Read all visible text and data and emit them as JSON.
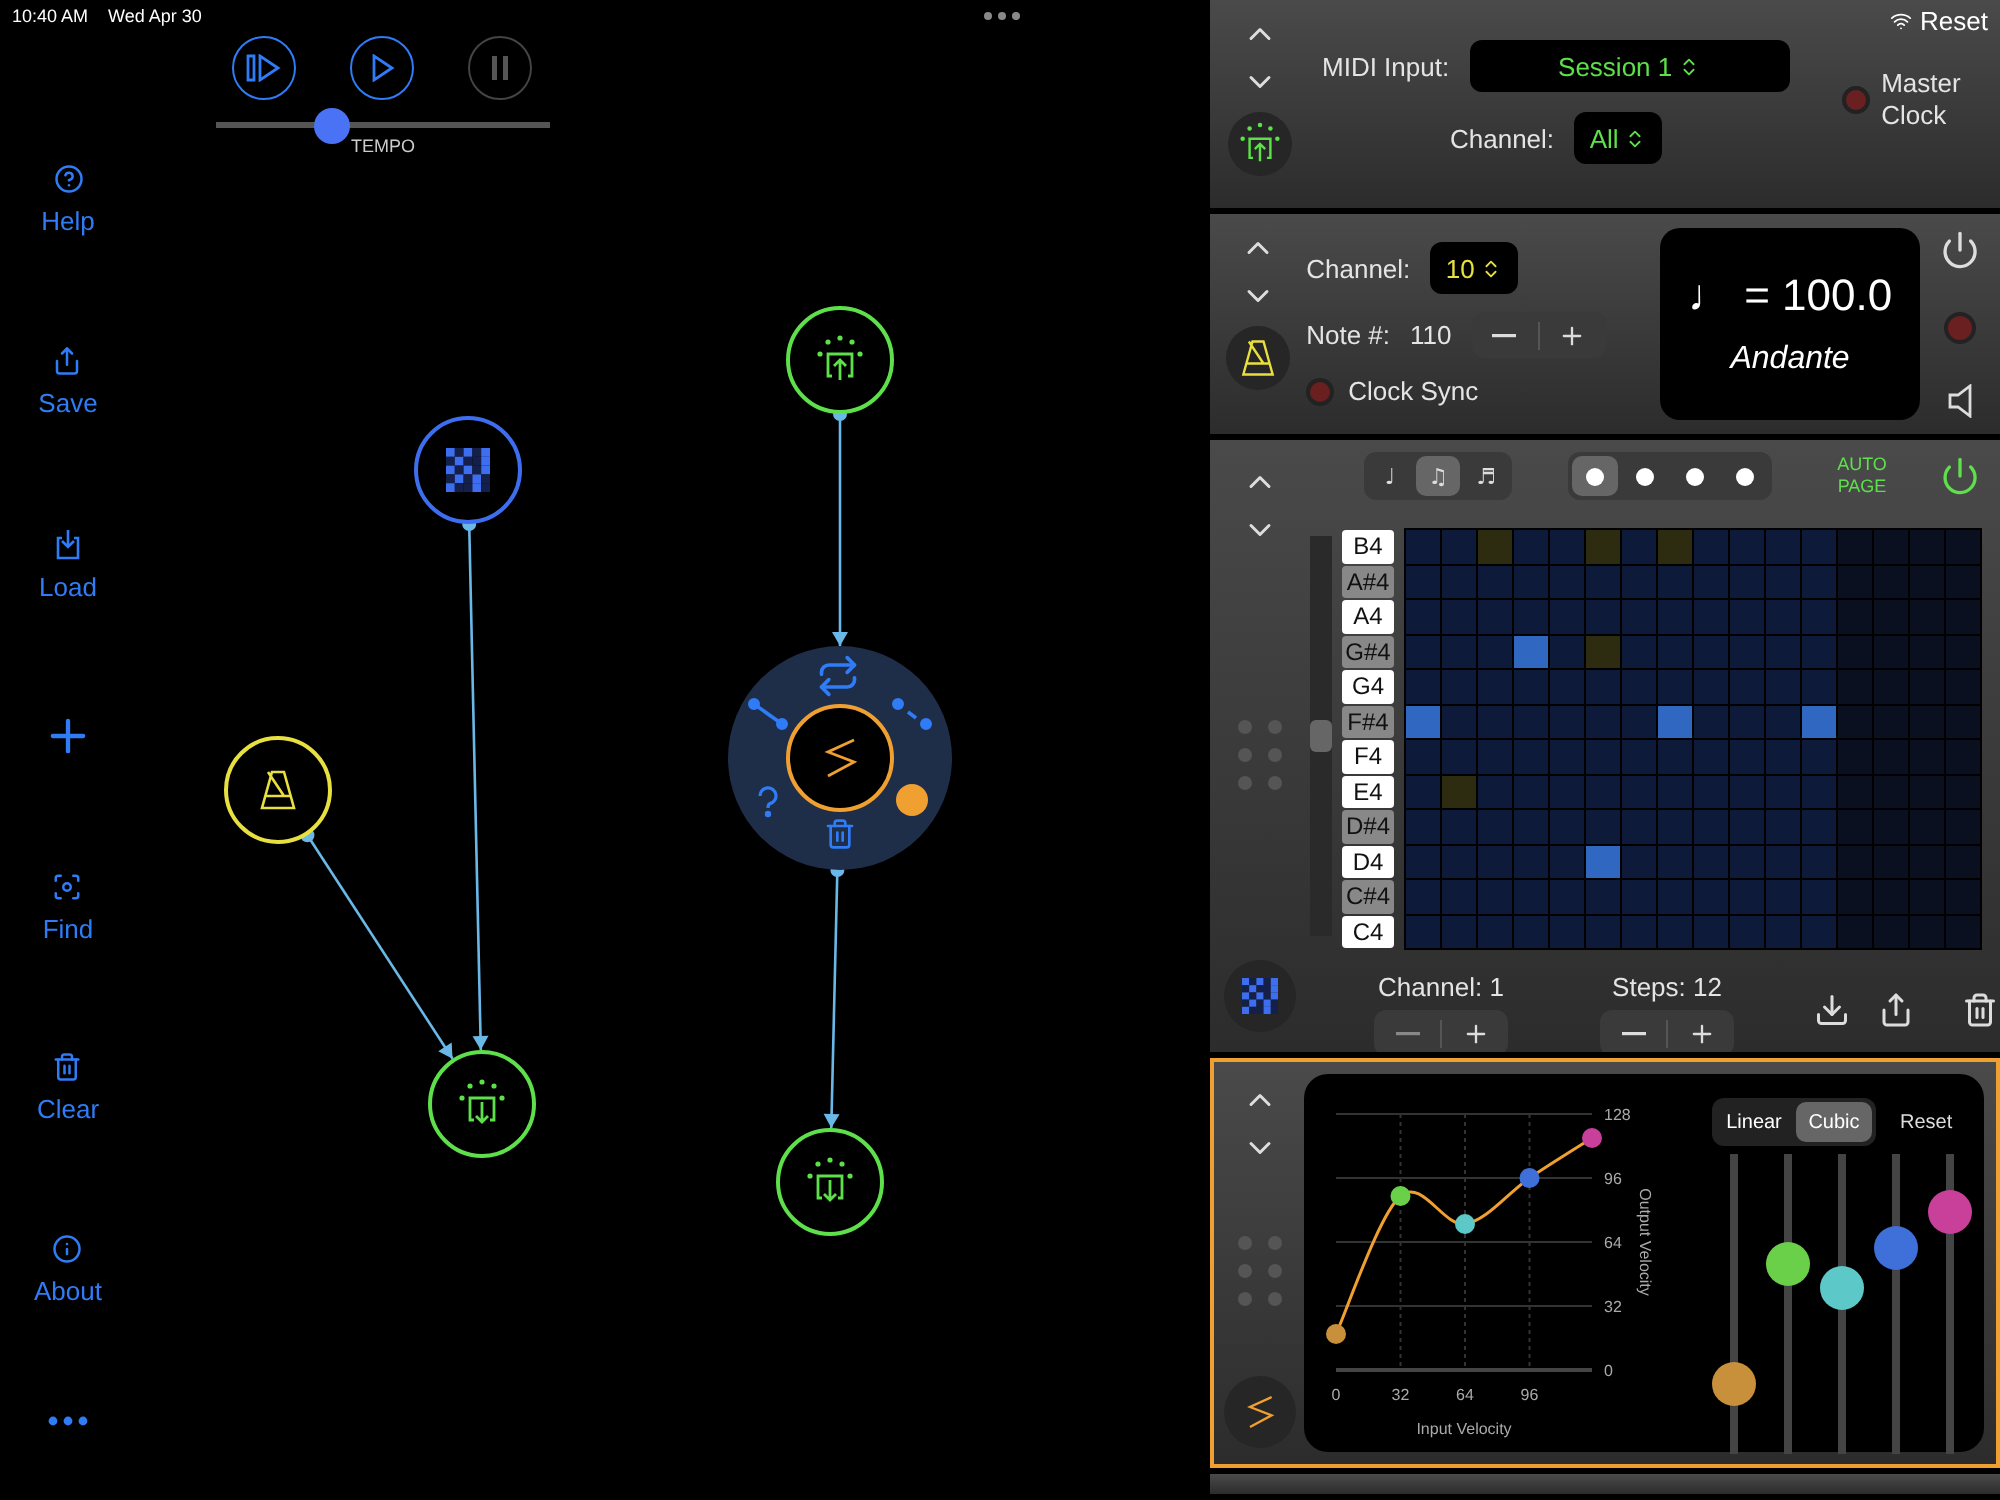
{
  "status_bar": {
    "time": "10:40 AM",
    "date": "Wed Apr 30"
  },
  "transport": {
    "buttons": [
      {
        "kind": "step-play",
        "disabled": false
      },
      {
        "kind": "play",
        "disabled": false
      },
      {
        "kind": "pause",
        "disabled": true
      }
    ],
    "tempo": {
      "label": "TEMPO",
      "level": 0.35
    }
  },
  "sidebar": {
    "items": [
      {
        "kind": "help",
        "label": "Help"
      },
      {
        "kind": "save",
        "label": "Save"
      },
      {
        "kind": "load",
        "label": "Load"
      },
      {
        "kind": "add"
      },
      {
        "kind": "find",
        "label": "Find"
      },
      {
        "kind": "clear",
        "label": "Clear"
      },
      {
        "kind": "about",
        "label": "About"
      },
      {
        "kind": "more"
      }
    ]
  },
  "canvas": {
    "nodes": [
      {
        "kind": "midi-in",
        "color": "#5de04a",
        "expanded": false
      },
      {
        "kind": "sequencer",
        "color": "#3d6ef0",
        "expanded": false
      },
      {
        "kind": "metronome",
        "color": "#e8e040",
        "expanded": false
      },
      {
        "kind": "velocity",
        "color": "#f0a030",
        "expanded": true
      },
      {
        "kind": "midi-out",
        "color": "#5de04a",
        "expanded": false
      },
      {
        "kind": "midi-out",
        "color": "#5de04a",
        "expanded": false
      }
    ]
  },
  "midi_input_panel": {
    "reset": "Reset",
    "input_label": "MIDI Input:",
    "source": "Session 1",
    "channel_label": "Channel:",
    "channel": "All",
    "master_clock": {
      "label": "Master Clock",
      "on": false
    }
  },
  "metronome_panel": {
    "channel_label": "Channel:",
    "channel": "10",
    "note_label": "Note #:",
    "note": "110",
    "clock_sync": {
      "label": "Clock Sync",
      "on": false
    },
    "tempo": "♩ = 100.0",
    "tempo_name": "Andante"
  },
  "sequencer_panel": {
    "note_lengths": [
      {
        "symbol": "♩",
        "selected": false
      },
      {
        "symbol": "♫",
        "selected": true
      },
      {
        "symbol": "♬",
        "selected": false
      }
    ],
    "pages": [
      {
        "selected": true
      },
      {
        "selected": false
      },
      {
        "selected": false
      },
      {
        "selected": false
      }
    ],
    "auto_page": "AUTO PAGE",
    "on": true,
    "rows": [
      {
        "label": "B4",
        "kind": "white",
        "cells": [
          {
            "kind": "off"
          },
          {
            "kind": "off"
          },
          {
            "kind": "ghost"
          },
          {
            "kind": "off"
          },
          {
            "kind": "off"
          },
          {
            "kind": "ghost"
          },
          {
            "kind": "off"
          },
          {
            "kind": "ghost"
          },
          {
            "kind": "off"
          },
          {
            "kind": "off"
          },
          {
            "kind": "off"
          },
          {
            "kind": "off"
          },
          {
            "kind": "idle"
          },
          {
            "kind": "idle"
          },
          {
            "kind": "idle"
          },
          {
            "kind": "idle"
          }
        ]
      },
      {
        "label": "A#4",
        "kind": "black",
        "cells": [
          {
            "kind": "off"
          },
          {
            "kind": "off"
          },
          {
            "kind": "off"
          },
          {
            "kind": "off"
          },
          {
            "kind": "off"
          },
          {
            "kind": "off"
          },
          {
            "kind": "off"
          },
          {
            "kind": "off"
          },
          {
            "kind": "off"
          },
          {
            "kind": "off"
          },
          {
            "kind": "off"
          },
          {
            "kind": "off"
          },
          {
            "kind": "idle"
          },
          {
            "kind": "idle"
          },
          {
            "kind": "idle"
          },
          {
            "kind": "idle"
          }
        ]
      },
      {
        "label": "A4",
        "kind": "white",
        "cells": [
          {
            "kind": "off"
          },
          {
            "kind": "off"
          },
          {
            "kind": "off"
          },
          {
            "kind": "off"
          },
          {
            "kind": "off"
          },
          {
            "kind": "off"
          },
          {
            "kind": "off"
          },
          {
            "kind": "off"
          },
          {
            "kind": "off"
          },
          {
            "kind": "off"
          },
          {
            "kind": "off"
          },
          {
            "kind": "off"
          },
          {
            "kind": "idle"
          },
          {
            "kind": "idle"
          },
          {
            "kind": "idle"
          },
          {
            "kind": "idle"
          }
        ]
      },
      {
        "label": "G#4",
        "kind": "black",
        "cells": [
          {
            "kind": "off"
          },
          {
            "kind": "off"
          },
          {
            "kind": "off"
          },
          {
            "kind": "note"
          },
          {
            "kind": "off"
          },
          {
            "kind": "ghost"
          },
          {
            "kind": "off"
          },
          {
            "kind": "off"
          },
          {
            "kind": "off"
          },
          {
            "kind": "off"
          },
          {
            "kind": "off"
          },
          {
            "kind": "off"
          },
          {
            "kind": "idle"
          },
          {
            "kind": "idle"
          },
          {
            "kind": "idle"
          },
          {
            "kind": "idle"
          }
        ]
      },
      {
        "label": "G4",
        "kind": "white",
        "cells": [
          {
            "kind": "off"
          },
          {
            "kind": "off"
          },
          {
            "kind": "off"
          },
          {
            "kind": "off"
          },
          {
            "kind": "off"
          },
          {
            "kind": "off"
          },
          {
            "kind": "off"
          },
          {
            "kind": "off"
          },
          {
            "kind": "off"
          },
          {
            "kind": "off"
          },
          {
            "kind": "off"
          },
          {
            "kind": "off"
          },
          {
            "kind": "idle"
          },
          {
            "kind": "idle"
          },
          {
            "kind": "idle"
          },
          {
            "kind": "idle"
          }
        ]
      },
      {
        "label": "F#4",
        "kind": "black",
        "cells": [
          {
            "kind": "note"
          },
          {
            "kind": "off"
          },
          {
            "kind": "off"
          },
          {
            "kind": "off"
          },
          {
            "kind": "off"
          },
          {
            "kind": "off"
          },
          {
            "kind": "off"
          },
          {
            "kind": "note"
          },
          {
            "kind": "off"
          },
          {
            "kind": "off"
          },
          {
            "kind": "off"
          },
          {
            "kind": "note"
          },
          {
            "kind": "idle"
          },
          {
            "kind": "idle"
          },
          {
            "kind": "idle"
          },
          {
            "kind": "idle"
          }
        ]
      },
      {
        "label": "F4",
        "kind": "white",
        "cells": [
          {
            "kind": "off"
          },
          {
            "kind": "off"
          },
          {
            "kind": "off"
          },
          {
            "kind": "off"
          },
          {
            "kind": "off"
          },
          {
            "kind": "off"
          },
          {
            "kind": "off"
          },
          {
            "kind": "off"
          },
          {
            "kind": "off"
          },
          {
            "kind": "off"
          },
          {
            "kind": "off"
          },
          {
            "kind": "off"
          },
          {
            "kind": "idle"
          },
          {
            "kind": "idle"
          },
          {
            "kind": "idle"
          },
          {
            "kind": "idle"
          }
        ]
      },
      {
        "label": "E4",
        "kind": "white",
        "cells": [
          {
            "kind": "off"
          },
          {
            "kind": "ghost"
          },
          {
            "kind": "off"
          },
          {
            "kind": "off"
          },
          {
            "kind": "off"
          },
          {
            "kind": "off"
          },
          {
            "kind": "off"
          },
          {
            "kind": "off"
          },
          {
            "kind": "off"
          },
          {
            "kind": "off"
          },
          {
            "kind": "off"
          },
          {
            "kind": "off"
          },
          {
            "kind": "idle"
          },
          {
            "kind": "idle"
          },
          {
            "kind": "idle"
          },
          {
            "kind": "idle"
          }
        ]
      },
      {
        "label": "D#4",
        "kind": "black",
        "cells": [
          {
            "kind": "off"
          },
          {
            "kind": "off"
          },
          {
            "kind": "off"
          },
          {
            "kind": "off"
          },
          {
            "kind": "off"
          },
          {
            "kind": "off"
          },
          {
            "kind": "off"
          },
          {
            "kind": "off"
          },
          {
            "kind": "off"
          },
          {
            "kind": "off"
          },
          {
            "kind": "off"
          },
          {
            "kind": "off"
          },
          {
            "kind": "idle"
          },
          {
            "kind": "idle"
          },
          {
            "kind": "idle"
          },
          {
            "kind": "idle"
          }
        ]
      },
      {
        "label": "D4",
        "kind": "white",
        "cells": [
          {
            "kind": "off"
          },
          {
            "kind": "off"
          },
          {
            "kind": "off"
          },
          {
            "kind": "off"
          },
          {
            "kind": "off"
          },
          {
            "kind": "note"
          },
          {
            "kind": "off"
          },
          {
            "kind": "off"
          },
          {
            "kind": "off"
          },
          {
            "kind": "off"
          },
          {
            "kind": "off"
          },
          {
            "kind": "off"
          },
          {
            "kind": "idle"
          },
          {
            "kind": "idle"
          },
          {
            "kind": "idle"
          },
          {
            "kind": "idle"
          }
        ]
      },
      {
        "label": "C#4",
        "kind": "black",
        "cells": [
          {
            "kind": "off"
          },
          {
            "kind": "off"
          },
          {
            "kind": "off"
          },
          {
            "kind": "off"
          },
          {
            "kind": "off"
          },
          {
            "kind": "off"
          },
          {
            "kind": "off"
          },
          {
            "kind": "off"
          },
          {
            "kind": "off"
          },
          {
            "kind": "off"
          },
          {
            "kind": "off"
          },
          {
            "kind": "off"
          },
          {
            "kind": "idle"
          },
          {
            "kind": "idle"
          },
          {
            "kind": "idle"
          },
          {
            "kind": "idle"
          }
        ]
      },
      {
        "label": "C4",
        "kind": "white",
        "cells": [
          {
            "kind": "off"
          },
          {
            "kind": "off"
          },
          {
            "kind": "off"
          },
          {
            "kind": "off"
          },
          {
            "kind": "off"
          },
          {
            "kind": "off"
          },
          {
            "kind": "off"
          },
          {
            "kind": "off"
          },
          {
            "kind": "off"
          },
          {
            "kind": "off"
          },
          {
            "kind": "off"
          },
          {
            "kind": "off"
          },
          {
            "kind": "idle"
          },
          {
            "kind": "idle"
          },
          {
            "kind": "idle"
          },
          {
            "kind": "idle"
          }
        ]
      }
    ],
    "channel": "Channel: 1",
    "steps": "Steps: 12"
  },
  "velocity_panel": {
    "modes": [
      {
        "label": "Linear",
        "selected": false
      },
      {
        "label": "Cubic",
        "selected": true
      }
    ],
    "reset": "Reset",
    "chart_data": {
      "type": "line",
      "xlabel": "Input Velocity",
      "ylabel": "Output Velocity",
      "x": [
        0,
        32,
        64,
        96,
        127
      ],
      "xlim": [
        0,
        127
      ],
      "ylim": [
        0,
        128
      ],
      "xticks": [
        0,
        32,
        64,
        96
      ],
      "yticks": [
        0,
        32,
        64,
        96,
        128
      ],
      "grid": true,
      "series": [
        {
          "color": "#f0a030",
          "marker": "circle",
          "values": [
            18,
            87,
            73,
            96,
            116
          ]
        }
      ]
    },
    "sliders": [
      {
        "color": "#c8903a",
        "level": 0.19
      },
      {
        "color": "#6ad04a",
        "level": 0.66
      },
      {
        "color": "#5cc8c8",
        "level": 0.56
      },
      {
        "color": "#3f6fd8",
        "level": 0.72
      },
      {
        "color": "#c8409a",
        "level": 0.86
      }
    ]
  }
}
